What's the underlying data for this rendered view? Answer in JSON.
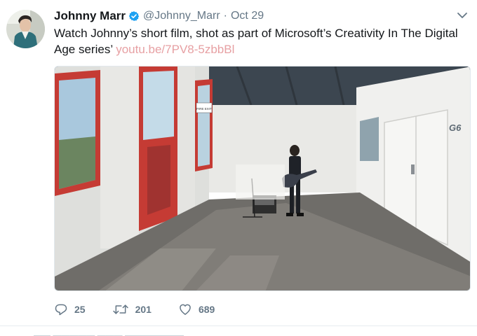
{
  "tweet": {
    "author_name": "Johnny Marr",
    "handle": "@Johnny_Marr",
    "separator": "·",
    "time": "Oct 29",
    "text": "Watch Johnny’s short film, shot as part of Microsoft’s Creativity In The Digital Age series’",
    "link_text": "youtu.be/7PV8-5zbbBl",
    "media": {
      "sign_text": "FIRE EXIT",
      "door_label": "G6"
    },
    "icons": {
      "verified": "verified-badge-icon",
      "caret": "chevron-down-icon",
      "reply": "reply-icon",
      "retweet": "retweet-icon",
      "like": "heart-icon"
    },
    "counts": {
      "reply": "25",
      "retweet": "201",
      "like": "689"
    }
  },
  "colors": {
    "verified": "#1da1f2",
    "link": "#e7a0a3",
    "muted": "#657786"
  }
}
